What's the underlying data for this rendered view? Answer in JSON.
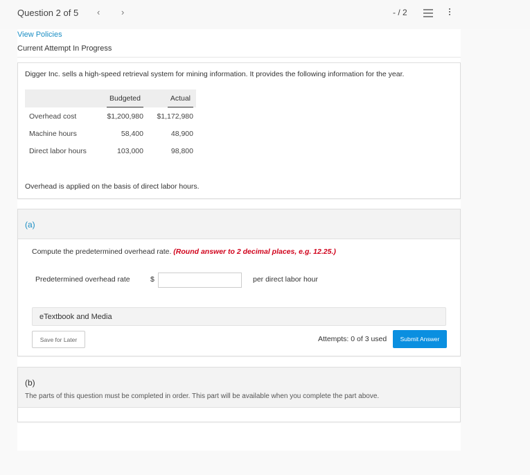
{
  "topbar": {
    "question_label": "Question 2 of 5",
    "prev_icon": "chevron-left-icon",
    "next_icon": "chevron-right-icon",
    "score": "- / 2",
    "list_icon": "list-icon",
    "more_icon": "more-vertical-icon"
  },
  "header": {
    "policies_link": "View Policies",
    "attempt_status": "Current Attempt In Progress"
  },
  "intro": {
    "text": "Digger Inc. sells a high-speed retrieval system for mining information. It provides the following information for the year.",
    "table": {
      "columns": [
        "",
        "Budgeted",
        "Actual"
      ],
      "rows": [
        [
          "Overhead cost",
          "$1,200,980",
          "$1,172,980"
        ],
        [
          "Machine hours",
          "58,400",
          "48,900"
        ],
        [
          "Direct labor hours",
          "103,000",
          "98,800"
        ]
      ]
    },
    "note": "Overhead is applied on the basis of direct labor hours."
  },
  "part_a": {
    "label": "(a)",
    "prompt": "Compute the predetermined overhead rate.",
    "hint": "(Round answer to 2 decimal places, e.g. 12.25.)",
    "answer_label": "Predetermined overhead rate",
    "currency": "$",
    "answer_value": "",
    "unit": "per direct labor hour",
    "etextbook": "eTextbook and Media",
    "save_button": "Save for Later",
    "attempts": "Attempts: 0 of 3 used",
    "submit_button": "Submit Answer",
    "accent_color": "#0a8fe0"
  },
  "part_b": {
    "label": "(b)",
    "message": "The parts of this question must be completed in order. This part will be available when you complete the part above."
  }
}
